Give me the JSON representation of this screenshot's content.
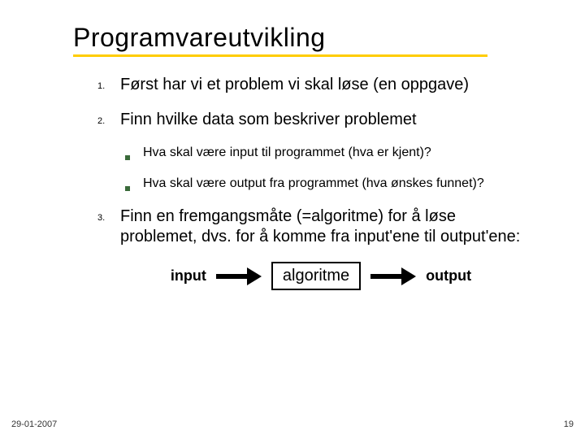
{
  "title": "Programvareutvikling",
  "items": [
    {
      "marker": "1.",
      "text": "Først  har vi et problem vi skal løse (en oppgave)"
    },
    {
      "marker": "2.",
      "text": "Finn hvilke data som beskriver problemet",
      "sub": [
        "Hva skal være input til programmet (hva er kjent)?",
        "Hva skal være output fra programmet (hva ønskes funnet)?"
      ]
    },
    {
      "marker": "3.",
      "text": "Finn en fremgangsmåte (=algoritme) for å løse problemet, dvs. for å komme fra input'ene til output'ene:"
    }
  ],
  "diagram": {
    "input": "input",
    "algorithm": "algoritme",
    "output": "output"
  },
  "footer": {
    "date": "29-01-2007",
    "page": "19"
  }
}
